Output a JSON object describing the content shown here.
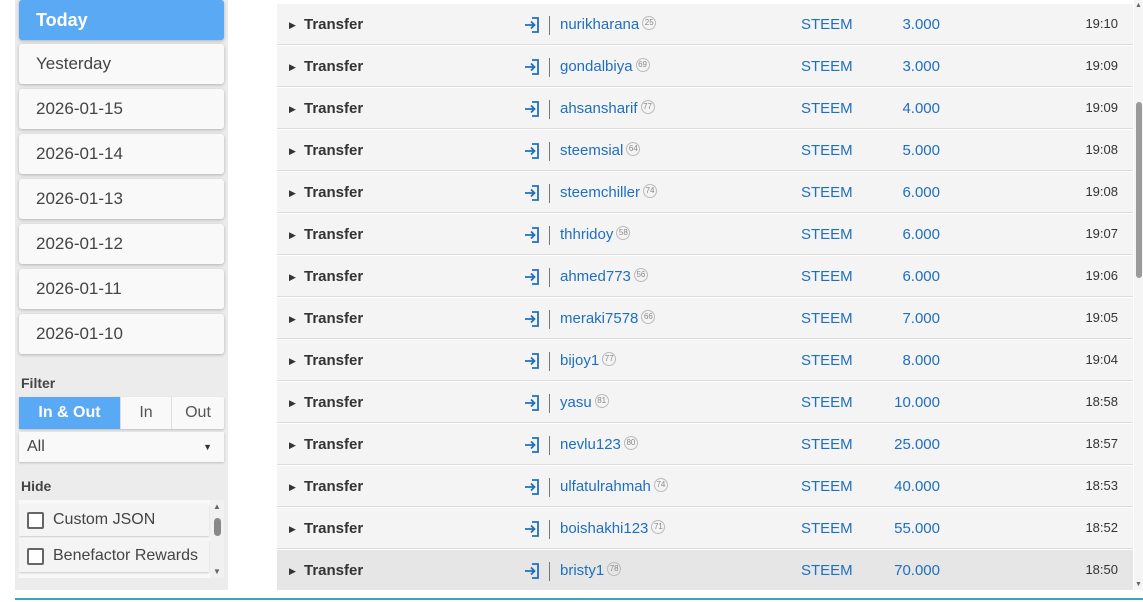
{
  "sidebar": {
    "dates": [
      "Today",
      "Yesterday",
      "2026-01-15",
      "2026-01-14",
      "2026-01-13",
      "2026-01-12",
      "2026-01-11",
      "2026-01-10"
    ],
    "filter_label": "Filter",
    "filter_options": [
      "In & Out",
      "In",
      "Out"
    ],
    "filter_selected": "In & Out",
    "select_value": "All",
    "hide_label": "Hide",
    "hide_items": [
      "Custom JSON",
      "Benefactor Rewards"
    ]
  },
  "transactions": [
    {
      "type": "Transfer",
      "user": "nurikharana",
      "rep": "25",
      "asset": "STEEM",
      "amount": "3.000",
      "time": "19:10"
    },
    {
      "type": "Transfer",
      "user": "gondalbiya",
      "rep": "69",
      "asset": "STEEM",
      "amount": "3.000",
      "time": "19:09"
    },
    {
      "type": "Transfer",
      "user": "ahsansharif",
      "rep": "77",
      "asset": "STEEM",
      "amount": "4.000",
      "time": "19:09"
    },
    {
      "type": "Transfer",
      "user": "steemsial",
      "rep": "64",
      "asset": "STEEM",
      "amount": "5.000",
      "time": "19:08"
    },
    {
      "type": "Transfer",
      "user": "steemchiller",
      "rep": "74",
      "asset": "STEEM",
      "amount": "6.000",
      "time": "19:08"
    },
    {
      "type": "Transfer",
      "user": "thhridoy",
      "rep": "58",
      "asset": "STEEM",
      "amount": "6.000",
      "time": "19:07"
    },
    {
      "type": "Transfer",
      "user": "ahmed773",
      "rep": "56",
      "asset": "STEEM",
      "amount": "6.000",
      "time": "19:06"
    },
    {
      "type": "Transfer",
      "user": "meraki7578",
      "rep": "66",
      "asset": "STEEM",
      "amount": "7.000",
      "time": "19:05"
    },
    {
      "type": "Transfer",
      "user": "bijoy1",
      "rep": "77",
      "asset": "STEEM",
      "amount": "8.000",
      "time": "19:04"
    },
    {
      "type": "Transfer",
      "user": "yasu",
      "rep": "81",
      "asset": "STEEM",
      "amount": "10.000",
      "time": "18:58"
    },
    {
      "type": "Transfer",
      "user": "nevlu123",
      "rep": "80",
      "asset": "STEEM",
      "amount": "25.000",
      "time": "18:57"
    },
    {
      "type": "Transfer",
      "user": "ulfatulrahmah",
      "rep": "74",
      "asset": "STEEM",
      "amount": "40.000",
      "time": "18:53"
    },
    {
      "type": "Transfer",
      "user": "boishakhi123",
      "rep": "71",
      "asset": "STEEM",
      "amount": "55.000",
      "time": "18:52"
    },
    {
      "type": "Transfer",
      "user": "bristy1",
      "rep": "78",
      "asset": "STEEM",
      "amount": "70.000",
      "time": "18:50"
    }
  ],
  "colors": {
    "accent": "#5aa9f4",
    "link": "#1f6fbf",
    "row_bg": "#f4f4f4",
    "sidebar_bg": "#ececec"
  },
  "icons": {
    "row_expand": "caret-right-icon",
    "incoming": "sign-in-icon",
    "select_caret": "caret-down-icon"
  }
}
